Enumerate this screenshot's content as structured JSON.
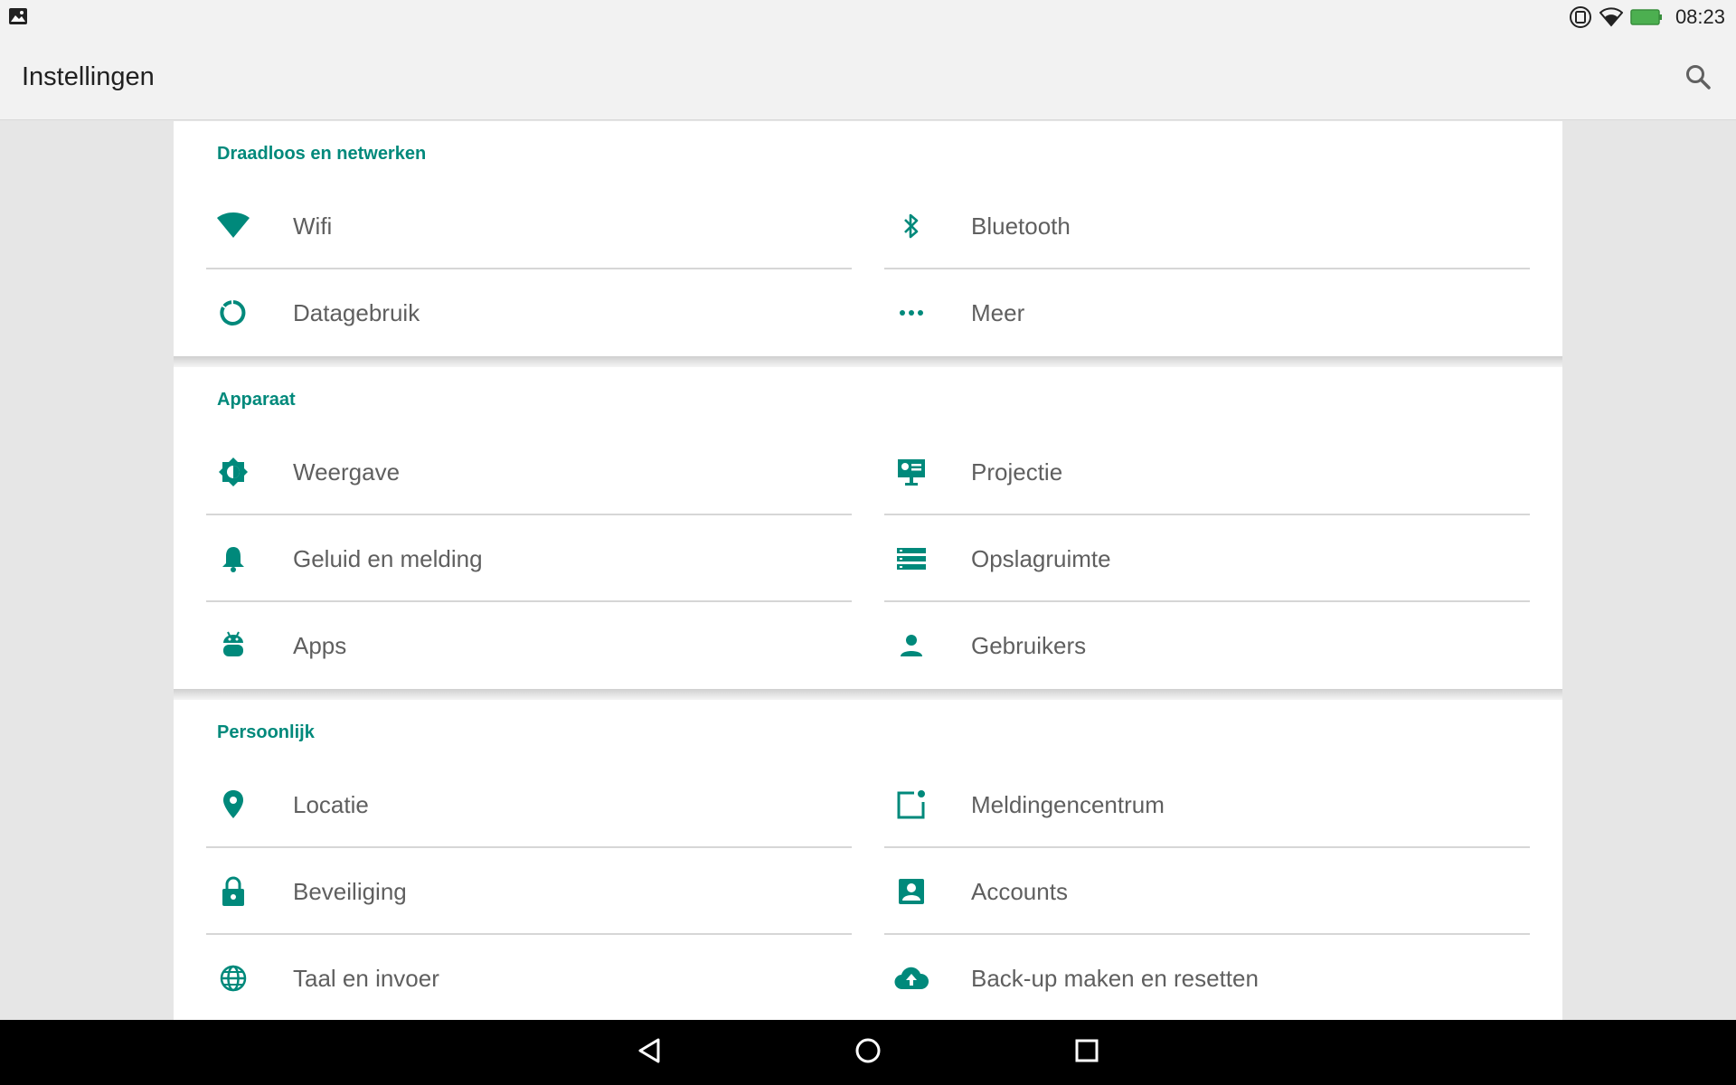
{
  "status_bar": {
    "time": "08:23"
  },
  "app_bar": {
    "title": "Instellingen"
  },
  "sections": [
    {
      "title": "Draadloos en netwerken",
      "items": [
        {
          "label": "Wifi",
          "icon": "wifi-icon"
        },
        {
          "label": "Bluetooth",
          "icon": "bluetooth-icon"
        },
        {
          "label": "Datagebruik",
          "icon": "data-usage-icon"
        },
        {
          "label": "Meer",
          "icon": "more-icon"
        }
      ]
    },
    {
      "title": "Apparaat",
      "items": [
        {
          "label": "Weergave",
          "icon": "brightness-icon"
        },
        {
          "label": "Projectie",
          "icon": "projection-icon"
        },
        {
          "label": "Geluid en melding",
          "icon": "bell-icon"
        },
        {
          "label": "Opslagruimte",
          "icon": "storage-icon"
        },
        {
          "label": "Apps",
          "icon": "android-icon"
        },
        {
          "label": "Gebruikers",
          "icon": "person-icon"
        }
      ]
    },
    {
      "title": "Persoonlijk",
      "items": [
        {
          "label": "Locatie",
          "icon": "location-icon"
        },
        {
          "label": "Meldingencentrum",
          "icon": "notification-center-icon"
        },
        {
          "label": "Beveiliging",
          "icon": "lock-icon"
        },
        {
          "label": "Accounts",
          "icon": "account-box-icon"
        },
        {
          "label": "Taal en invoer",
          "icon": "globe-icon"
        },
        {
          "label": "Back-up maken en resetten",
          "icon": "cloud-upload-icon"
        }
      ]
    }
  ],
  "colors": {
    "accent": "#00897b",
    "text": "#5f5f5f",
    "background": "#e6e6e6"
  }
}
